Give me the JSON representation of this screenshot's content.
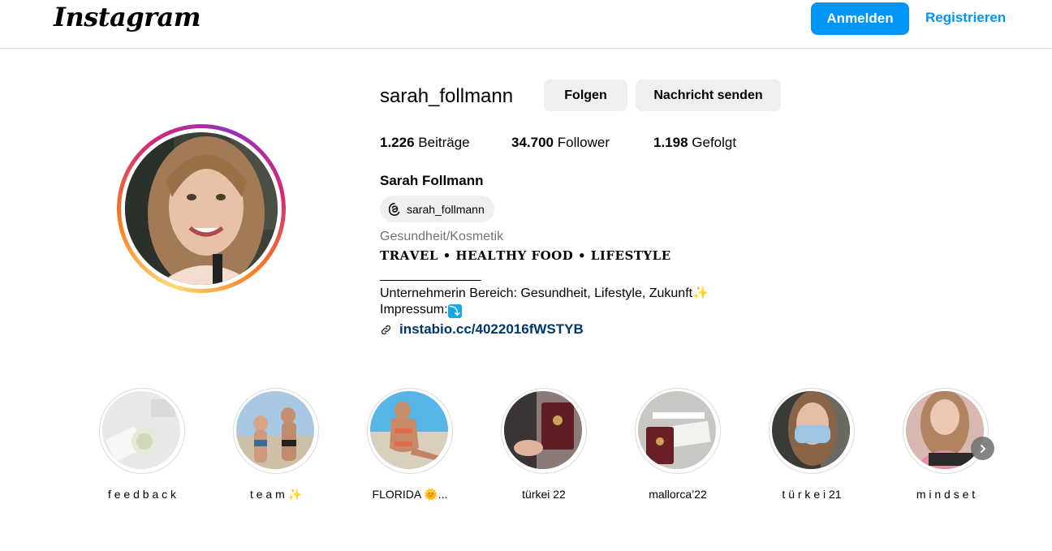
{
  "header": {
    "logo": "Instagram",
    "login_label": "Anmelden",
    "register_label": "Registrieren"
  },
  "profile": {
    "username": "sarah_follmann",
    "follow_label": "Folgen",
    "message_label": "Nachricht senden",
    "stats": {
      "posts_count": "1.226",
      "posts_label": "Beiträge",
      "followers_count": "34.700",
      "followers_label": "Follower",
      "following_count": "1.198",
      "following_label": "Gefolgt"
    },
    "full_name": "Sarah Follmann",
    "threads_handle": "sarah_follmann",
    "category": "Gesundheit/Kosmetik",
    "bio": {
      "line1": "𝐓𝐑𝐀𝐕𝐄𝐋 • 𝐇𝐄𝐀𝐋𝐓𝐇𝐘 𝐅𝐎𝐎𝐃 • 𝐋𝐈𝐅𝐄𝐒𝐓𝐘𝐋𝐄",
      "line2": "______________",
      "line3": "Unternehmerin Bereich: Gesundheit, Lifestyle, Zukunft✨",
      "line4": "Impressum:",
      "line4_emoji": "⤵"
    },
    "link": "instabio.cc/4022016fWSTYB"
  },
  "highlights": [
    {
      "label": "f e e d b a c k"
    },
    {
      "label": "t e a m ✨"
    },
    {
      "label": "FLORIDA 🌞..."
    },
    {
      "label": "türkei 22"
    },
    {
      "label": "mallorca’22"
    },
    {
      "label": "t ü r k e i 21"
    },
    {
      "label": "m i n d s e t"
    }
  ],
  "colors": {
    "primary_blue": "#0095f6",
    "link_blue": "#00376b",
    "secondary_btn": "#efefef",
    "muted_text": "#737373"
  },
  "icons": [
    "threads-icon",
    "link-icon",
    "chevron-right-icon"
  ]
}
